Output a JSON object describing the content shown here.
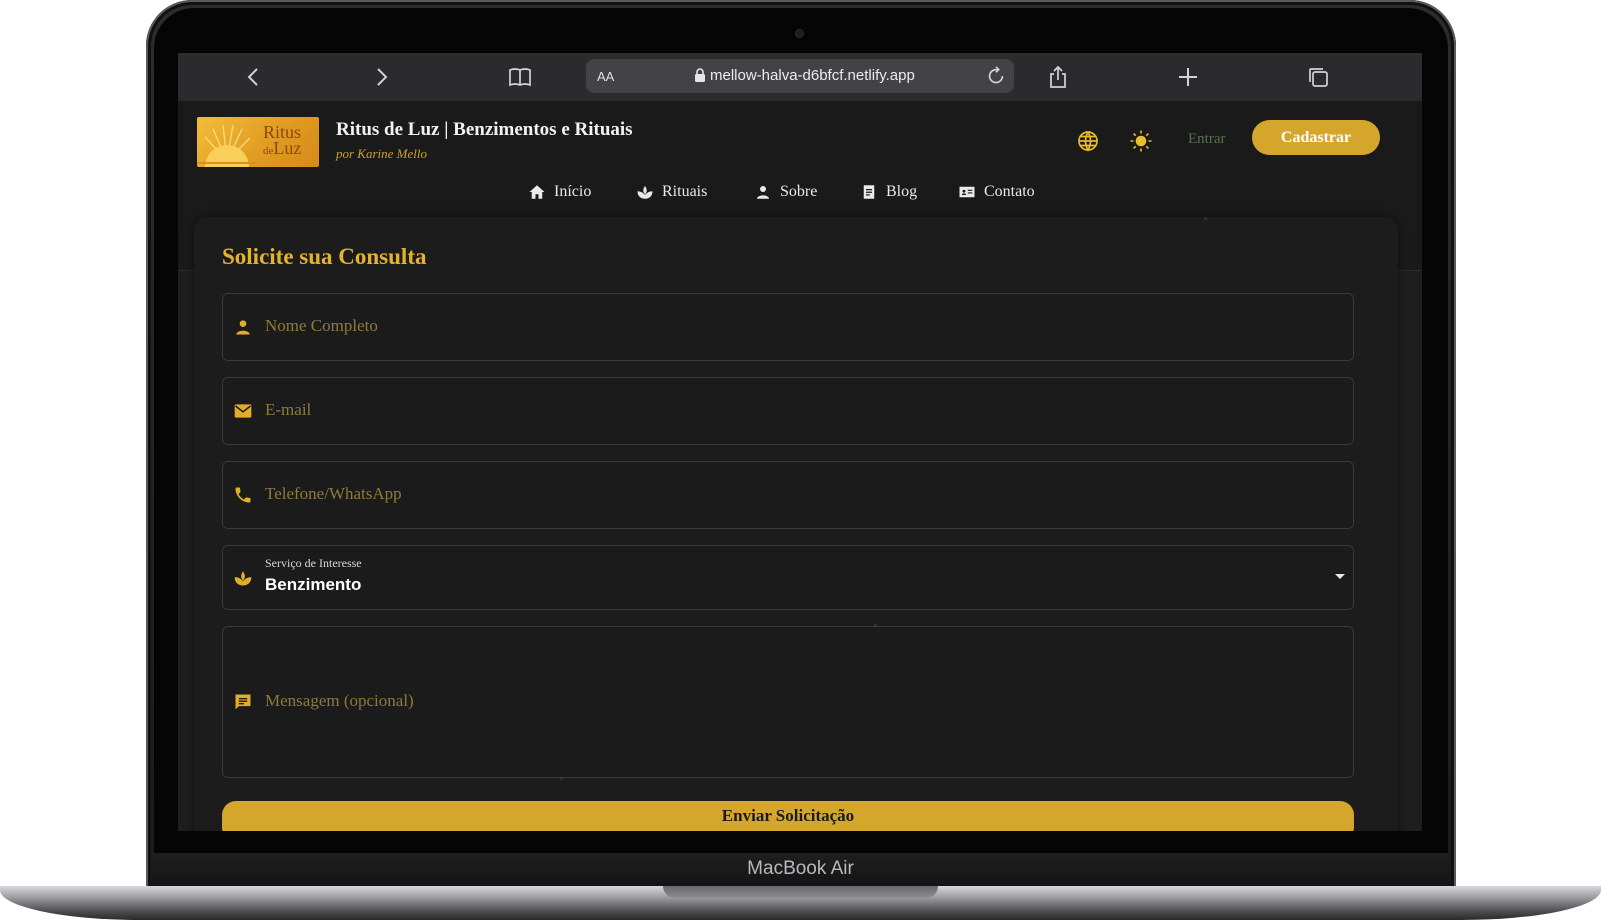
{
  "device": {
    "label": "MacBook Air"
  },
  "browser": {
    "reader_label": "AA",
    "url": "mellow-halva-d6bfcf.netlify.app",
    "icons": [
      "chevron-left-icon",
      "chevron-right-icon",
      "book-icon",
      "lock-icon",
      "reload-icon",
      "share-icon",
      "plus-icon",
      "tabs-icon"
    ]
  },
  "site": {
    "logo": {
      "line1": "Ritus",
      "line2_small": "de",
      "line2": "Luz"
    },
    "title": "Ritus de Luz | Benzimentos e Rituais",
    "subtitle": "por Karine Mello",
    "login_label": "Entrar",
    "signup_label": "Cadastrar",
    "accent": "#d4a72c",
    "nav": [
      {
        "label": "Início",
        "icon": "home-icon"
      },
      {
        "label": "Rituais",
        "icon": "lotus-icon"
      },
      {
        "label": "Sobre",
        "icon": "person-icon"
      },
      {
        "label": "Blog",
        "icon": "article-icon"
      },
      {
        "label": "Contato",
        "icon": "contact-card-icon"
      }
    ]
  },
  "form": {
    "title": "Solicite sua Consulta",
    "name_placeholder": "Nome Completo",
    "email_placeholder": "E-mail",
    "phone_placeholder": "Telefone/WhatsApp",
    "service": {
      "label": "Serviço de Interesse",
      "value": "Benzimento"
    },
    "message_placeholder": "Mensagem (opcional)",
    "submit_label": "Enviar Solicitação"
  }
}
